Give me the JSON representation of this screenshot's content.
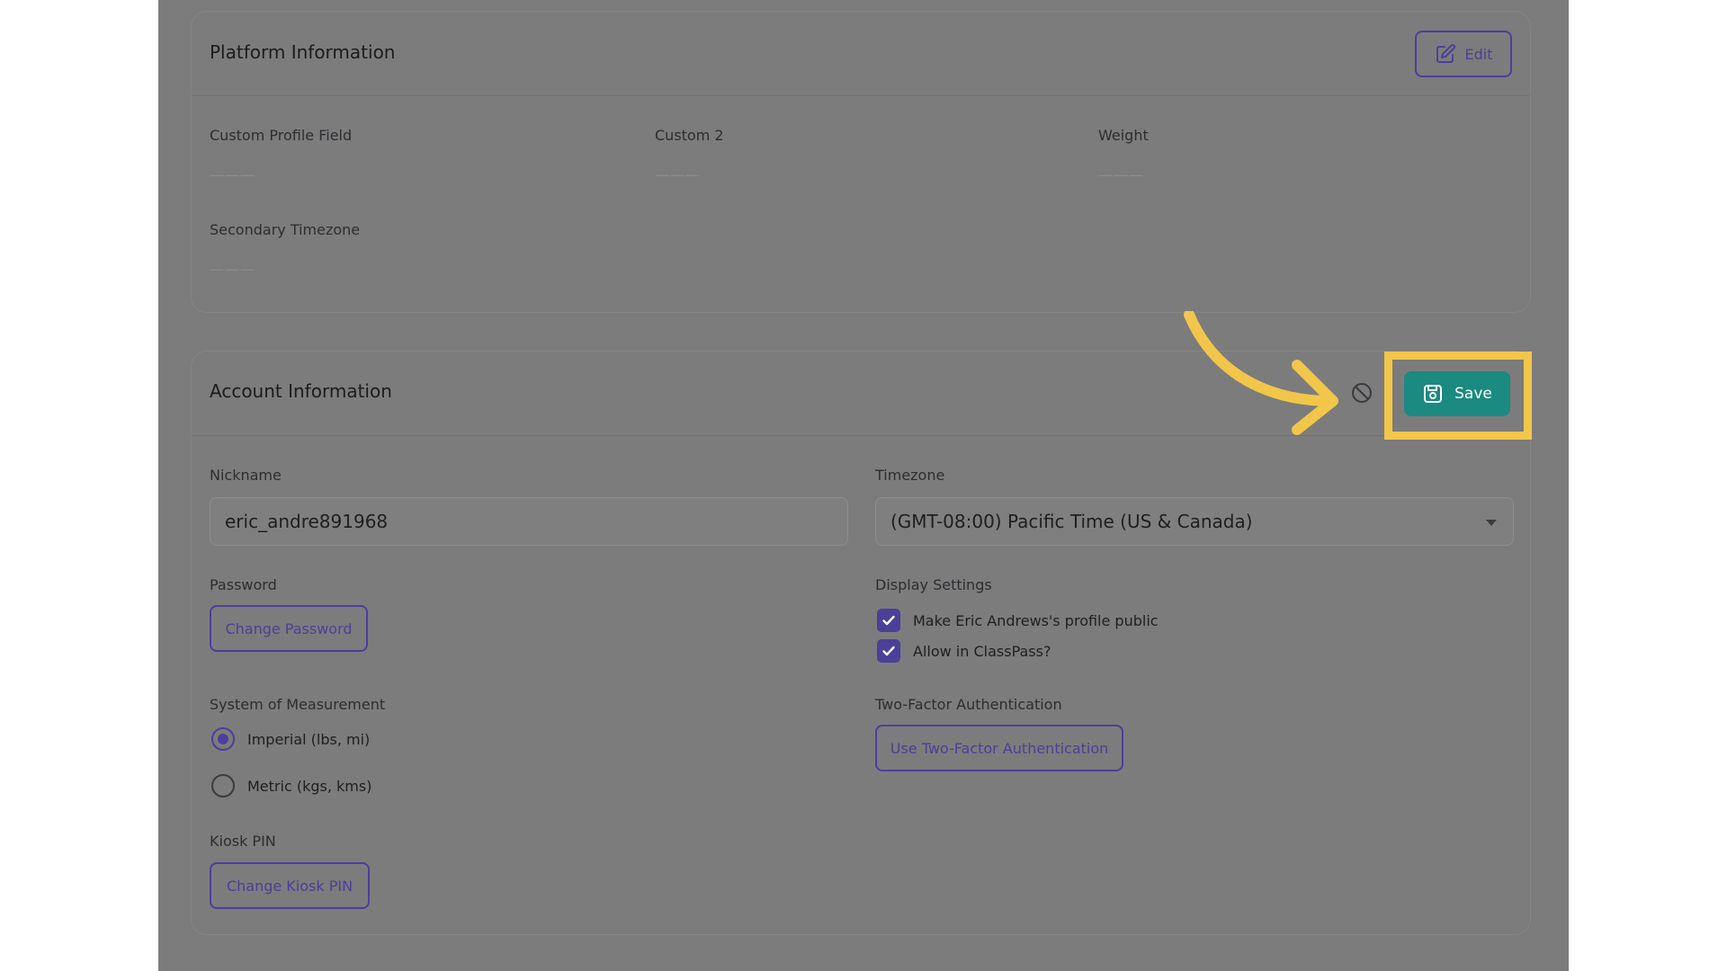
{
  "platform_info": {
    "title": "Platform Information",
    "edit_label": "Edit",
    "fields": [
      {
        "label": "Custom Profile Field",
        "value": "———"
      },
      {
        "label": "Custom 2",
        "value": "———"
      },
      {
        "label": "Weight",
        "value": "———"
      },
      {
        "label": "Secondary Timezone",
        "value": "———"
      }
    ]
  },
  "account_info": {
    "title": "Account Information",
    "save_label": "Save",
    "nickname": {
      "label": "Nickname",
      "value": "eric_andre891968"
    },
    "timezone": {
      "label": "Timezone",
      "value": "(GMT-08:00) Pacific Time (US & Canada)"
    },
    "password": {
      "label": "Password",
      "button": "Change Password"
    },
    "display_settings": {
      "label": "Display Settings",
      "options": [
        {
          "label": "Make Eric Andrews's profile public",
          "checked": true
        },
        {
          "label": "Allow in ClassPass?",
          "checked": true
        }
      ]
    },
    "measurement": {
      "label": "System of Measurement",
      "options": [
        {
          "label": "Imperial (lbs, mi)",
          "selected": true
        },
        {
          "label": "Metric (kgs, kms)",
          "selected": false
        }
      ]
    },
    "two_factor": {
      "label": "Two-Factor Authentication",
      "button": "Use Two-Factor Authentication"
    },
    "kiosk": {
      "label": "Kiosk PIN",
      "button": "Change Kiosk PIN"
    }
  },
  "colors": {
    "accent": "#4b3f9a",
    "save": "#1b8a80",
    "highlight": "#f2c64a",
    "overlay": "#7c7c7c"
  },
  "icons": [
    "edit-icon",
    "eye-off-icon",
    "save-disk-icon",
    "check-icon",
    "arrow-pointer"
  ]
}
